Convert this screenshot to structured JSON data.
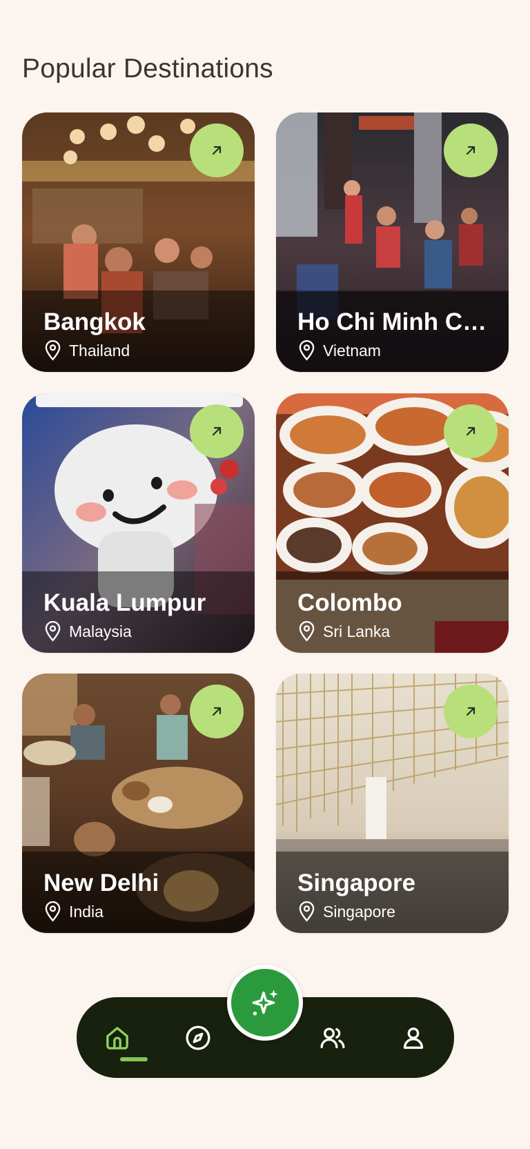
{
  "header": {
    "title": "Popular Destinations"
  },
  "destinations": [
    {
      "city": "Bangkok",
      "country": "Thailand"
    },
    {
      "city": "Ho Chi Minh Ci...",
      "country": "Vietnam"
    },
    {
      "city": "Kuala Lumpur",
      "country": "Malaysia"
    },
    {
      "city": "Colombo",
      "country": "Sri Lanka"
    },
    {
      "city": "New Delhi",
      "country": "India"
    },
    {
      "city": "Singapore",
      "country": "Singapore"
    }
  ],
  "nav": {
    "items": [
      "home-icon",
      "compass-icon",
      "sparkle-icon",
      "people-icon",
      "person-icon"
    ],
    "active": "home-icon"
  },
  "colors": {
    "background": "#fcf4ee",
    "accent_lime": "#b8e07a",
    "nav_bar": "#17210d",
    "fab": "#2b9a3c",
    "indicator": "#86c45a"
  }
}
